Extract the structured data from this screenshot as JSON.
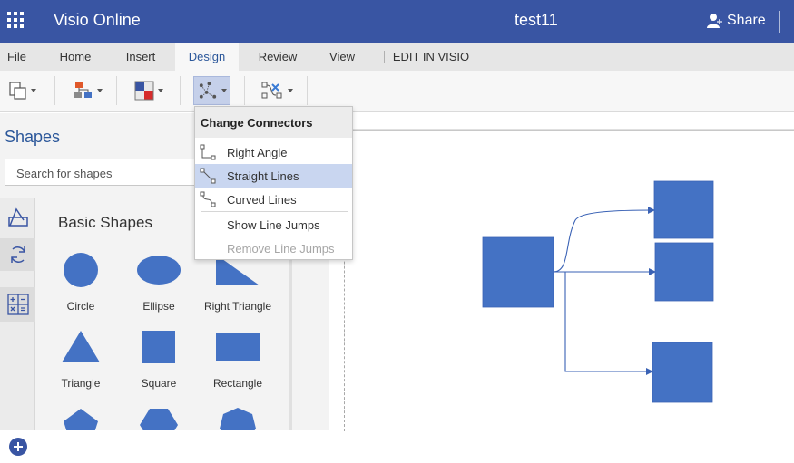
{
  "header": {
    "app_title": "Visio Online",
    "doc_title": "test11",
    "share_label": "Share"
  },
  "tabs": [
    {
      "label": "File"
    },
    {
      "label": "Home"
    },
    {
      "label": "Insert"
    },
    {
      "label": "Design",
      "active": true
    },
    {
      "label": "Review"
    },
    {
      "label": "View"
    },
    {
      "label": "EDIT IN VISIO"
    }
  ],
  "ribbon": {
    "buttons": [
      "page-size-icon",
      "diagram-layout-icon",
      "theme-colors-icon",
      "connectors-icon",
      "connector-style-icon"
    ]
  },
  "menu": {
    "title": "Change Connectors",
    "items": [
      {
        "label": "Right Angle",
        "icon": "right-angle-connector-icon"
      },
      {
        "label": "Straight Lines",
        "icon": "straight-connector-icon",
        "highlighted": true
      },
      {
        "label": "Curved Lines",
        "icon": "curved-connector-icon"
      },
      {
        "label": "Show Line Jumps"
      },
      {
        "label": "Remove Line Jumps",
        "disabled": true
      }
    ]
  },
  "shapes_pane": {
    "title": "Shapes",
    "search_placeholder": "Search for shapes",
    "stencil_title": "Basic Shapes",
    "shapes": [
      {
        "label": "Circle"
      },
      {
        "label": "Ellipse"
      },
      {
        "label": "Right Triangle"
      },
      {
        "label": "Triangle"
      },
      {
        "label": "Square"
      },
      {
        "label": "Rectangle"
      }
    ]
  },
  "colors": {
    "header_bg": "#3955a3",
    "shape_fill": "#4472c4",
    "accent": "#2b579a",
    "menu_highlight": "#c9d6f0"
  }
}
